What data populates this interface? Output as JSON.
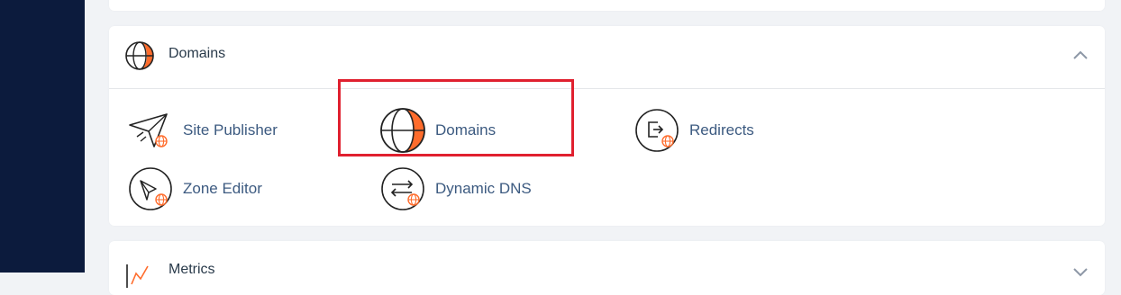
{
  "sections": {
    "domains": {
      "title": "Domains",
      "icon": "globe-icon",
      "expanded": true,
      "items": [
        {
          "label": "Site Publisher",
          "icon": "paper-plane-icon"
        },
        {
          "label": "Domains",
          "icon": "globe-icon"
        },
        {
          "label": "Redirects",
          "icon": "redirect-icon"
        },
        {
          "label": "Zone Editor",
          "icon": "zone-editor-icon"
        },
        {
          "label": "Dynamic DNS",
          "icon": "dynamic-dns-icon"
        }
      ]
    },
    "metrics": {
      "title": "Metrics",
      "icon": "metrics-icon"
    }
  },
  "colors": {
    "accent": "#ff6c2c",
    "sidebar": "#0c1b3d",
    "highlight": "#e0202f",
    "link": "#3c5a80"
  }
}
